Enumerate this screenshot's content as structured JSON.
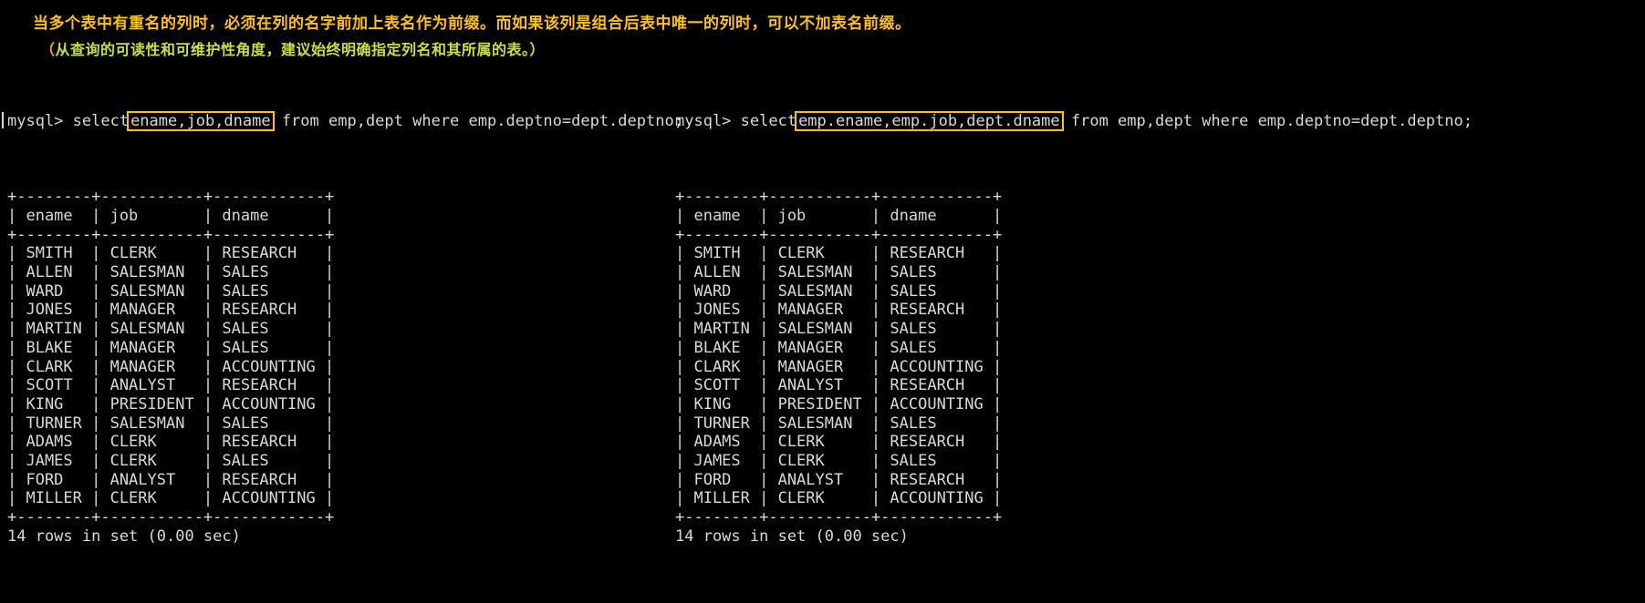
{
  "annotation": {
    "line1": "当多个表中有重名的列时，必须在列的名字前加上表名作为前缀。而如果该列是组合后表中唯一的列时，可以不加表名前缀。",
    "line2_open_paren": "（",
    "line2_body": "从查询的可读性和可维护性角度，建议始终明确指定列名和其所属的表。）",
    "line1_color": "#ffc20e",
    "line2_color": "#c8e03a",
    "highlight_color": "#ffc20e"
  },
  "left_pane": {
    "prompt_prefix": "mysql> select",
    "highlighted_columns": "ename,job,dname",
    "prompt_suffix": " from emp,dept where emp.deptno=dept.deptno;",
    "separator": "+--------+-----------+------------+",
    "header_row": "| ename  | job       | dname      |",
    "status": "14 rows in set (0.00 sec)",
    "columns": [
      "ename",
      "job",
      "dname"
    ],
    "rows": [
      [
        "SMITH",
        "CLERK",
        "RESEARCH"
      ],
      [
        "ALLEN",
        "SALESMAN",
        "SALES"
      ],
      [
        "WARD",
        "SALESMAN",
        "SALES"
      ],
      [
        "JONES",
        "MANAGER",
        "RESEARCH"
      ],
      [
        "MARTIN",
        "SALESMAN",
        "SALES"
      ],
      [
        "BLAKE",
        "MANAGER",
        "SALES"
      ],
      [
        "CLARK",
        "MANAGER",
        "ACCOUNTING"
      ],
      [
        "SCOTT",
        "ANALYST",
        "RESEARCH"
      ],
      [
        "KING",
        "PRESIDENT",
        "ACCOUNTING"
      ],
      [
        "TURNER",
        "SALESMAN",
        "SALES"
      ],
      [
        "ADAMS",
        "CLERK",
        "RESEARCH"
      ],
      [
        "JAMES",
        "CLERK",
        "SALES"
      ],
      [
        "FORD",
        "ANALYST",
        "RESEARCH"
      ],
      [
        "MILLER",
        "CLERK",
        "ACCOUNTING"
      ]
    ],
    "body_lines": [
      "| SMITH  | CLERK     | RESEARCH   |",
      "| ALLEN  | SALESMAN  | SALES      |",
      "| WARD   | SALESMAN  | SALES      |",
      "| JONES  | MANAGER   | RESEARCH   |",
      "| MARTIN | SALESMAN  | SALES      |",
      "| BLAKE  | MANAGER   | SALES      |",
      "| CLARK  | MANAGER   | ACCOUNTING |",
      "| SCOTT  | ANALYST   | RESEARCH   |",
      "| KING   | PRESIDENT | ACCOUNTING |",
      "| TURNER | SALESMAN  | SALES      |",
      "| ADAMS  | CLERK     | RESEARCH   |",
      "| JAMES  | CLERK     | SALES      |",
      "| FORD   | ANALYST   | RESEARCH   |",
      "| MILLER | CLERK     | ACCOUNTING |"
    ]
  },
  "right_pane": {
    "prompt_prefix": "mysql> select",
    "highlighted_columns": "emp.ename,emp.job,dept.dname",
    "prompt_suffix": " from emp,dept where emp.deptno=dept.deptno;",
    "separator": "+--------+-----------+------------+",
    "header_row": "| ename  | job       | dname      |",
    "status": "14 rows in set (0.00 sec)",
    "columns": [
      "ename",
      "job",
      "dname"
    ],
    "rows": [
      [
        "SMITH",
        "CLERK",
        "RESEARCH"
      ],
      [
        "ALLEN",
        "SALESMAN",
        "SALES"
      ],
      [
        "WARD",
        "SALESMAN",
        "SALES"
      ],
      [
        "JONES",
        "MANAGER",
        "RESEARCH"
      ],
      [
        "MARTIN",
        "SALESMAN",
        "SALES"
      ],
      [
        "BLAKE",
        "MANAGER",
        "SALES"
      ],
      [
        "CLARK",
        "MANAGER",
        "ACCOUNTING"
      ],
      [
        "SCOTT",
        "ANALYST",
        "RESEARCH"
      ],
      [
        "KING",
        "PRESIDENT",
        "ACCOUNTING"
      ],
      [
        "TURNER",
        "SALESMAN",
        "SALES"
      ],
      [
        "ADAMS",
        "CLERK",
        "RESEARCH"
      ],
      [
        "JAMES",
        "CLERK",
        "SALES"
      ],
      [
        "FORD",
        "ANALYST",
        "RESEARCH"
      ],
      [
        "MILLER",
        "CLERK",
        "ACCOUNTING"
      ]
    ],
    "body_lines": [
      "| SMITH  | CLERK     | RESEARCH   |",
      "| ALLEN  | SALESMAN  | SALES      |",
      "| WARD   | SALESMAN  | SALES      |",
      "| JONES  | MANAGER   | RESEARCH   |",
      "| MARTIN | SALESMAN  | SALES      |",
      "| BLAKE  | MANAGER   | SALES      |",
      "| CLARK  | MANAGER   | ACCOUNTING |",
      "| SCOTT  | ANALYST   | RESEARCH   |",
      "| KING   | PRESIDENT | ACCOUNTING |",
      "| TURNER | SALESMAN  | SALES      |",
      "| ADAMS  | CLERK     | RESEARCH   |",
      "| JAMES  | CLERK     | SALES      |",
      "| FORD   | ANALYST   | RESEARCH   |",
      "| MILLER | CLERK     | ACCOUNTING |"
    ]
  }
}
